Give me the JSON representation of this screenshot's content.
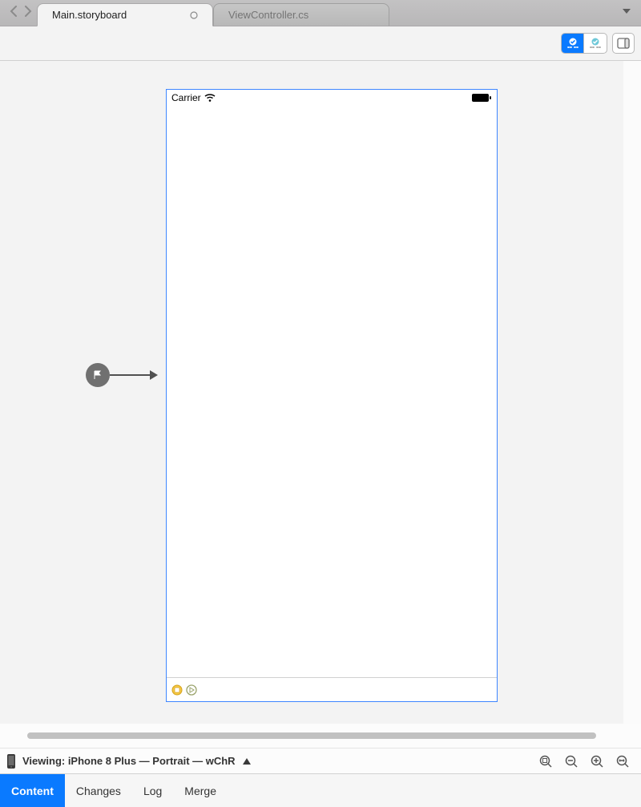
{
  "tabs": {
    "active_label": "Main.storyboard",
    "inactive_label": "ViewController.cs"
  },
  "status_bar": {
    "carrier": "Carrier"
  },
  "viewing": {
    "text": "Viewing: iPhone 8 Plus — Portrait — wChR"
  },
  "footer": {
    "content": "Content",
    "changes": "Changes",
    "log": "Log",
    "merge": "Merge"
  }
}
